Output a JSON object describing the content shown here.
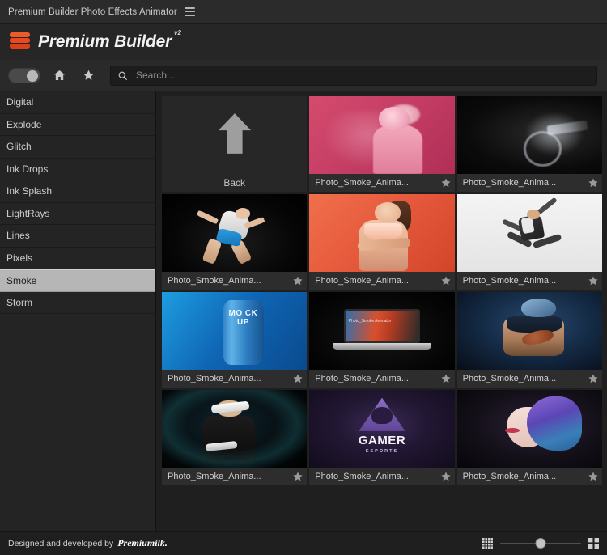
{
  "titlebar": {
    "title": "Premium Builder Photo Effects Animator",
    "menu_icon": "hamburger-icon"
  },
  "brand": {
    "name": "Premium Builder",
    "version": "v2",
    "logo_icon": "stacked-layers-icon",
    "accent_color": "#e8491f"
  },
  "toolbar": {
    "toggle": {
      "name": "view-toggle",
      "state": "on"
    },
    "home_icon": "home-icon",
    "favorites_icon": "star-icon",
    "search": {
      "placeholder": "Search...",
      "value": "",
      "icon": "search-icon"
    }
  },
  "sidebar": {
    "selected": "Smoke",
    "items": [
      {
        "label": "Digital",
        "selected": false
      },
      {
        "label": "Explode",
        "selected": false
      },
      {
        "label": "Glitch",
        "selected": false
      },
      {
        "label": "Ink Drops",
        "selected": false
      },
      {
        "label": "Ink Splash",
        "selected": false
      },
      {
        "label": "LightRays",
        "selected": false
      },
      {
        "label": "Lines",
        "selected": false
      },
      {
        "label": "Pixels",
        "selected": false
      },
      {
        "label": "Smoke",
        "selected": true
      },
      {
        "label": "Storm",
        "selected": false
      }
    ]
  },
  "content": {
    "back_tile": {
      "label": "Back",
      "icon": "arrow-up-icon"
    },
    "favorite_icon": "star-icon",
    "items": [
      {
        "label": "Photo_Smoke_Anima...",
        "art": "art-pink",
        "favorited": false
      },
      {
        "label": "Photo_Smoke_Anima...",
        "art": "art-moto",
        "favorited": false
      },
      {
        "label": "Photo_Smoke_Anima...",
        "art": "art-run",
        "favorited": false
      },
      {
        "label": "Photo_Smoke_Anima...",
        "art": "art-orange",
        "favorited": false
      },
      {
        "label": "Photo_Smoke_Anima...",
        "art": "art-white",
        "favorited": false
      },
      {
        "label": "Photo_Smoke_Anima...",
        "art": "art-blue",
        "favorited": false
      },
      {
        "label": "Photo_Smoke_Anima...",
        "art": "art-lap",
        "favorited": false
      },
      {
        "label": "Photo_Smoke_Anima...",
        "art": "art-foot",
        "favorited": false
      },
      {
        "label": "Photo_Smoke_Anima...",
        "art": "art-vr",
        "favorited": false
      },
      {
        "label": "Photo_Smoke_Anima...",
        "art": "art-gamer",
        "favorited": false
      },
      {
        "label": "Photo_Smoke_Anima...",
        "art": "art-purple",
        "favorited": false
      }
    ],
    "artwork_text": {
      "mockup_can": "MO CK UP",
      "laptop_screen": "Photo_Smoke Animator",
      "gamer_title": "GAMER",
      "gamer_subtitle": "ESPORTS"
    }
  },
  "footer": {
    "credit_text": "Designed and developed by",
    "credit_brand": "Premiumilk.",
    "small_grid_icon": "small-grid-icon",
    "large_grid_icon": "large-grid-icon",
    "zoom_slider": {
      "name": "thumbnail-size-slider",
      "value": 50
    }
  }
}
